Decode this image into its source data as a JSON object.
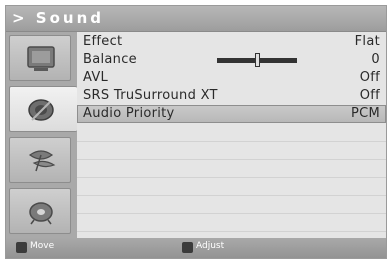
{
  "header": {
    "title": "> Sound"
  },
  "sidebar": {
    "items": [
      {
        "icon": "picture-icon"
      },
      {
        "icon": "speaker-icon",
        "active": true
      },
      {
        "icon": "satellite-dish-icon"
      },
      {
        "icon": "gear-icon"
      }
    ]
  },
  "menu": {
    "rows": [
      {
        "label": "Effect",
        "value": "Flat"
      },
      {
        "label": "Balance",
        "value": "0"
      },
      {
        "label": "AVL",
        "value": "Off"
      },
      {
        "label": "SRS TruSurround XT",
        "value": "Off"
      },
      {
        "label": "Audio Priority",
        "value": "PCM"
      }
    ],
    "balance_level": 0.5
  },
  "footer": {
    "move_label": "Move",
    "adjust_label": "Adjust"
  },
  "colors": {
    "header_bg": "#a9a9a9",
    "selected_row_bg": "#bebebe",
    "text": "#2a2a2a"
  }
}
